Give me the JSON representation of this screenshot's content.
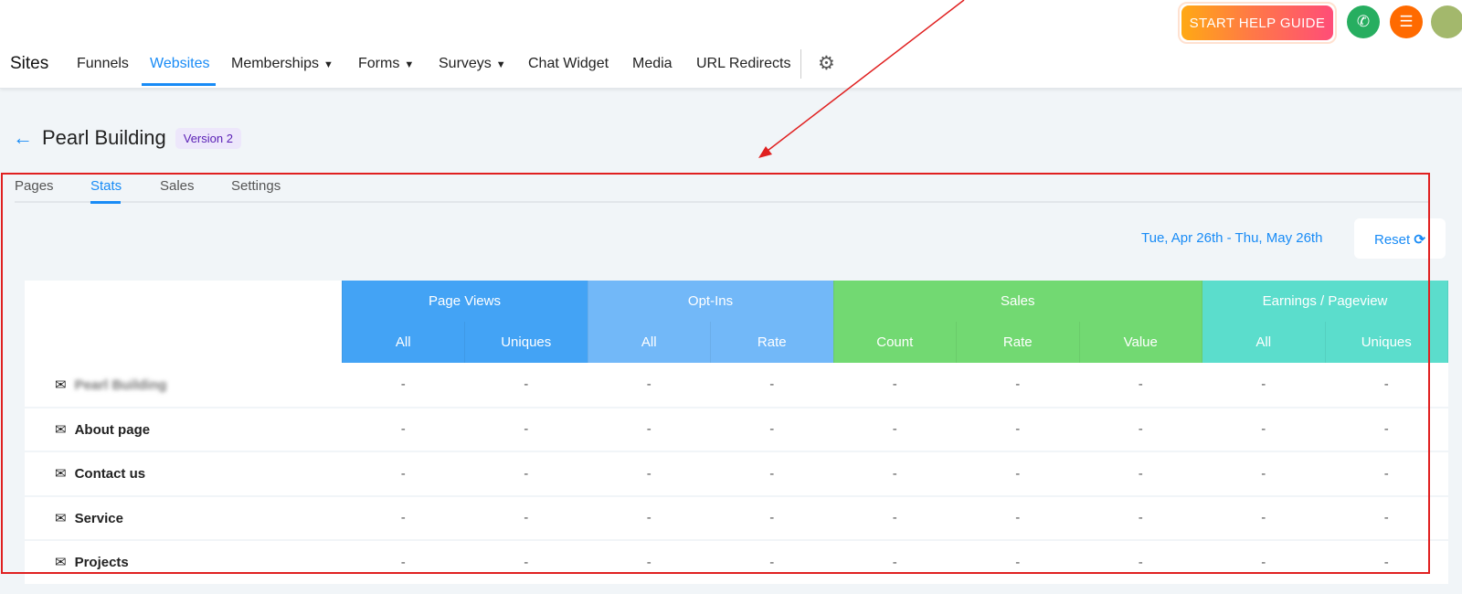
{
  "header": {
    "help_label": "START HELP GUIDE",
    "colors": {
      "phone": "#27ae60",
      "list": "#ff6a00"
    }
  },
  "nav": {
    "brand": "Sites",
    "items": [
      {
        "label": "Funnels",
        "dropdown": false
      },
      {
        "label": "Websites",
        "dropdown": false,
        "active": true
      },
      {
        "label": "Memberships",
        "dropdown": true
      },
      {
        "label": "Forms",
        "dropdown": true
      },
      {
        "label": "Surveys",
        "dropdown": true
      },
      {
        "label": "Chat Widget",
        "dropdown": false
      },
      {
        "label": "Media",
        "dropdown": false
      },
      {
        "label": "URL Redirects",
        "dropdown": false
      }
    ]
  },
  "page": {
    "title": "Pearl Building",
    "version": "Version 2"
  },
  "tabs": [
    "Pages",
    "Stats",
    "Sales",
    "Settings"
  ],
  "filters": {
    "date_range": "Tue, Apr 26th - Thu, May 26th",
    "reset_label": "Reset"
  },
  "table": {
    "groups": [
      {
        "label": "Page Views",
        "color": "#43a3f5",
        "cols": [
          "All",
          "Uniques"
        ]
      },
      {
        "label": "Opt-Ins",
        "color": "#72b8f8",
        "cols": [
          "All",
          "Rate"
        ]
      },
      {
        "label": "Sales",
        "color": "#72d972",
        "cols": [
          "Count",
          "Rate",
          "Value"
        ]
      },
      {
        "label": "Earnings / Pageview",
        "color": "#5bddcc",
        "cols": [
          "All",
          "Uniques"
        ]
      }
    ],
    "rows": [
      {
        "name": "Pearl Building",
        "blurred": true,
        "values": [
          "-",
          "-",
          "-",
          "-",
          "-",
          "-",
          "-",
          "-",
          "-"
        ]
      },
      {
        "name": "About page",
        "values": [
          "-",
          "-",
          "-",
          "-",
          "-",
          "-",
          "-",
          "-",
          "-"
        ]
      },
      {
        "name": "Contact us",
        "values": [
          "-",
          "-",
          "-",
          "-",
          "-",
          "-",
          "-",
          "-",
          "-"
        ]
      },
      {
        "name": "Service",
        "values": [
          "-",
          "-",
          "-",
          "-",
          "-",
          "-",
          "-",
          "-",
          "-"
        ]
      },
      {
        "name": "Projects",
        "values": [
          "-",
          "-",
          "-",
          "-",
          "-",
          "-",
          "-",
          "-",
          "-"
        ]
      }
    ]
  }
}
